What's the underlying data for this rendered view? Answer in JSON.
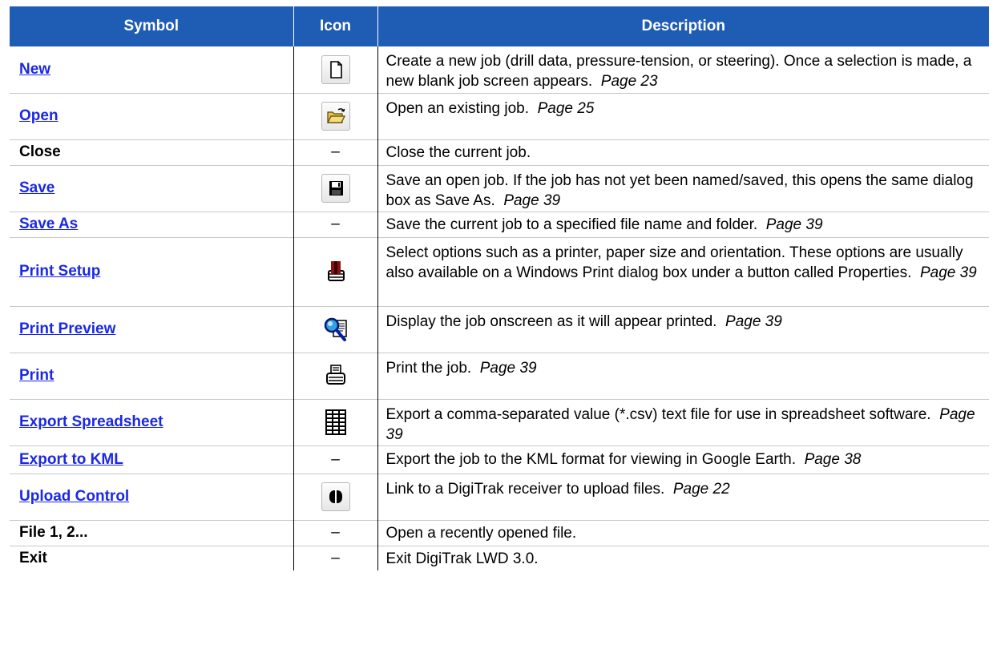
{
  "table": {
    "headers": {
      "symbol": "Symbol",
      "icon": "Icon",
      "description": "Description"
    },
    "rows": [
      {
        "symbol": "New",
        "icon": "new-document-icon",
        "description": "Create a new job (drill data, pressure-tension, or steering). Once a selection is made, a new blank job screen appears.",
        "page": "Page 23"
      },
      {
        "symbol": "Open",
        "icon": "open-folder-icon",
        "description": "Open an existing job.",
        "page": "Page 25"
      },
      {
        "symbol": "Close",
        "icon": "–",
        "description": "Close the current job.",
        "page": ""
      },
      {
        "symbol": "Save",
        "icon": "floppy-disk-icon",
        "description": "Save an open job. If the job has not yet been named/saved, this opens the same dialog box as Save As.",
        "page": "Page 39"
      },
      {
        "symbol": "Save As",
        "icon": "–",
        "description": "Save the current job to a specified file name and folder.",
        "page": "Page 39"
      },
      {
        "symbol": "Print Setup",
        "icon": "printer-setup-icon",
        "description": "Select options such as a printer, paper size and orientation. These options are usually also available on a Windows Print dialog box under a button called Properties.",
        "page": "Page 39"
      },
      {
        "symbol": "Print Preview",
        "icon": "print-preview-icon",
        "description": "Display the job onscreen as it will appear printed.",
        "page": "Page 39"
      },
      {
        "symbol": "Print",
        "icon": "printer-icon",
        "description": "Print the job.",
        "page": "Page 39"
      },
      {
        "symbol": "Export Spreadsheet",
        "icon": "spreadsheet-icon",
        "description": "Export a comma-separated value (*.csv) text file for use in spreadsheet software.",
        "page": "Page 39"
      },
      {
        "symbol": "Export to KML",
        "icon": "–",
        "description": "Export the job to the KML format for viewing in Google Earth.",
        "page": "Page 38"
      },
      {
        "symbol": "Upload Control",
        "icon": "upload-link-icon",
        "description": "Link to a DigiTrak receiver to upload files.",
        "page": "Page 22"
      },
      {
        "symbol": "File 1, 2...",
        "icon": "–",
        "description": "Open a recently opened file.",
        "page": ""
      },
      {
        "symbol": "Exit",
        "icon": "–",
        "description": "Exit DigiTrak LWD 3.0.",
        "page": ""
      }
    ]
  },
  "colors": {
    "header_bg": "#1f5cb4",
    "link": "#1a28e6"
  }
}
